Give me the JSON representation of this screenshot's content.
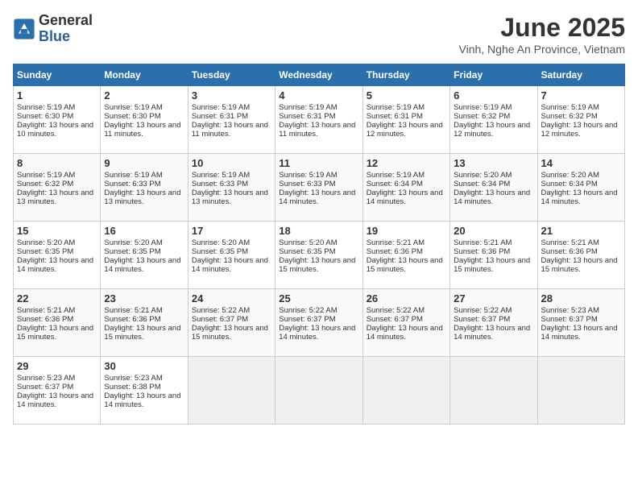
{
  "header": {
    "logo_general": "General",
    "logo_blue": "Blue",
    "title": "June 2025",
    "subtitle": "Vinh, Nghe An Province, Vietnam"
  },
  "calendar": {
    "days_of_week": [
      "Sunday",
      "Monday",
      "Tuesday",
      "Wednesday",
      "Thursday",
      "Friday",
      "Saturday"
    ],
    "weeks": [
      [
        {
          "day": "",
          "sunrise": "",
          "sunset": "",
          "daylight": ""
        },
        {
          "day": "",
          "sunrise": "",
          "sunset": "",
          "daylight": ""
        },
        {
          "day": "",
          "sunrise": "",
          "sunset": "",
          "daylight": ""
        },
        {
          "day": "",
          "sunrise": "",
          "sunset": "",
          "daylight": ""
        },
        {
          "day": "",
          "sunrise": "",
          "sunset": "",
          "daylight": ""
        },
        {
          "day": "",
          "sunrise": "",
          "sunset": "",
          "daylight": ""
        },
        {
          "day": "",
          "sunrise": "",
          "sunset": "",
          "daylight": ""
        }
      ],
      [
        {
          "day": "1",
          "sunrise": "Sunrise: 5:19 AM",
          "sunset": "Sunset: 6:30 PM",
          "daylight": "Daylight: 13 hours and 10 minutes."
        },
        {
          "day": "2",
          "sunrise": "Sunrise: 5:19 AM",
          "sunset": "Sunset: 6:30 PM",
          "daylight": "Daylight: 13 hours and 11 minutes."
        },
        {
          "day": "3",
          "sunrise": "Sunrise: 5:19 AM",
          "sunset": "Sunset: 6:31 PM",
          "daylight": "Daylight: 13 hours and 11 minutes."
        },
        {
          "day": "4",
          "sunrise": "Sunrise: 5:19 AM",
          "sunset": "Sunset: 6:31 PM",
          "daylight": "Daylight: 13 hours and 11 minutes."
        },
        {
          "day": "5",
          "sunrise": "Sunrise: 5:19 AM",
          "sunset": "Sunset: 6:31 PM",
          "daylight": "Daylight: 13 hours and 12 minutes."
        },
        {
          "day": "6",
          "sunrise": "Sunrise: 5:19 AM",
          "sunset": "Sunset: 6:32 PM",
          "daylight": "Daylight: 13 hours and 12 minutes."
        },
        {
          "day": "7",
          "sunrise": "Sunrise: 5:19 AM",
          "sunset": "Sunset: 6:32 PM",
          "daylight": "Daylight: 13 hours and 12 minutes."
        }
      ],
      [
        {
          "day": "8",
          "sunrise": "Sunrise: 5:19 AM",
          "sunset": "Sunset: 6:32 PM",
          "daylight": "Daylight: 13 hours and 13 minutes."
        },
        {
          "day": "9",
          "sunrise": "Sunrise: 5:19 AM",
          "sunset": "Sunset: 6:33 PM",
          "daylight": "Daylight: 13 hours and 13 minutes."
        },
        {
          "day": "10",
          "sunrise": "Sunrise: 5:19 AM",
          "sunset": "Sunset: 6:33 PM",
          "daylight": "Daylight: 13 hours and 13 minutes."
        },
        {
          "day": "11",
          "sunrise": "Sunrise: 5:19 AM",
          "sunset": "Sunset: 6:33 PM",
          "daylight": "Daylight: 13 hours and 14 minutes."
        },
        {
          "day": "12",
          "sunrise": "Sunrise: 5:19 AM",
          "sunset": "Sunset: 6:34 PM",
          "daylight": "Daylight: 13 hours and 14 minutes."
        },
        {
          "day": "13",
          "sunrise": "Sunrise: 5:20 AM",
          "sunset": "Sunset: 6:34 PM",
          "daylight": "Daylight: 13 hours and 14 minutes."
        },
        {
          "day": "14",
          "sunrise": "Sunrise: 5:20 AM",
          "sunset": "Sunset: 6:34 PM",
          "daylight": "Daylight: 13 hours and 14 minutes."
        }
      ],
      [
        {
          "day": "15",
          "sunrise": "Sunrise: 5:20 AM",
          "sunset": "Sunset: 6:35 PM",
          "daylight": "Daylight: 13 hours and 14 minutes."
        },
        {
          "day": "16",
          "sunrise": "Sunrise: 5:20 AM",
          "sunset": "Sunset: 6:35 PM",
          "daylight": "Daylight: 13 hours and 14 minutes."
        },
        {
          "day": "17",
          "sunrise": "Sunrise: 5:20 AM",
          "sunset": "Sunset: 6:35 PM",
          "daylight": "Daylight: 13 hours and 14 minutes."
        },
        {
          "day": "18",
          "sunrise": "Sunrise: 5:20 AM",
          "sunset": "Sunset: 6:35 PM",
          "daylight": "Daylight: 13 hours and 15 minutes."
        },
        {
          "day": "19",
          "sunrise": "Sunrise: 5:21 AM",
          "sunset": "Sunset: 6:36 PM",
          "daylight": "Daylight: 13 hours and 15 minutes."
        },
        {
          "day": "20",
          "sunrise": "Sunrise: 5:21 AM",
          "sunset": "Sunset: 6:36 PM",
          "daylight": "Daylight: 13 hours and 15 minutes."
        },
        {
          "day": "21",
          "sunrise": "Sunrise: 5:21 AM",
          "sunset": "Sunset: 6:36 PM",
          "daylight": "Daylight: 13 hours and 15 minutes."
        }
      ],
      [
        {
          "day": "22",
          "sunrise": "Sunrise: 5:21 AM",
          "sunset": "Sunset: 6:36 PM",
          "daylight": "Daylight: 13 hours and 15 minutes."
        },
        {
          "day": "23",
          "sunrise": "Sunrise: 5:21 AM",
          "sunset": "Sunset: 6:36 PM",
          "daylight": "Daylight: 13 hours and 15 minutes."
        },
        {
          "day": "24",
          "sunrise": "Sunrise: 5:22 AM",
          "sunset": "Sunset: 6:37 PM",
          "daylight": "Daylight: 13 hours and 15 minutes."
        },
        {
          "day": "25",
          "sunrise": "Sunrise: 5:22 AM",
          "sunset": "Sunset: 6:37 PM",
          "daylight": "Daylight: 13 hours and 14 minutes."
        },
        {
          "day": "26",
          "sunrise": "Sunrise: 5:22 AM",
          "sunset": "Sunset: 6:37 PM",
          "daylight": "Daylight: 13 hours and 14 minutes."
        },
        {
          "day": "27",
          "sunrise": "Sunrise: 5:22 AM",
          "sunset": "Sunset: 6:37 PM",
          "daylight": "Daylight: 13 hours and 14 minutes."
        },
        {
          "day": "28",
          "sunrise": "Sunrise: 5:23 AM",
          "sunset": "Sunset: 6:37 PM",
          "daylight": "Daylight: 13 hours and 14 minutes."
        }
      ],
      [
        {
          "day": "29",
          "sunrise": "Sunrise: 5:23 AM",
          "sunset": "Sunset: 6:37 PM",
          "daylight": "Daylight: 13 hours and 14 minutes."
        },
        {
          "day": "30",
          "sunrise": "Sunrise: 5:23 AM",
          "sunset": "Sunset: 6:38 PM",
          "daylight": "Daylight: 13 hours and 14 minutes."
        },
        {
          "day": "",
          "sunrise": "",
          "sunset": "",
          "daylight": ""
        },
        {
          "day": "",
          "sunrise": "",
          "sunset": "",
          "daylight": ""
        },
        {
          "day": "",
          "sunrise": "",
          "sunset": "",
          "daylight": ""
        },
        {
          "day": "",
          "sunrise": "",
          "sunset": "",
          "daylight": ""
        },
        {
          "day": "",
          "sunrise": "",
          "sunset": "",
          "daylight": ""
        }
      ]
    ]
  }
}
